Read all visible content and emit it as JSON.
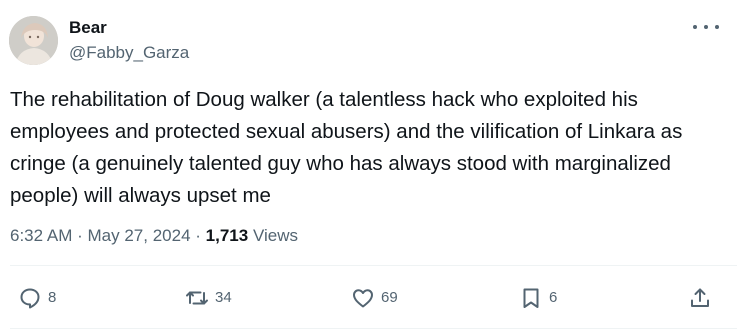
{
  "author": {
    "name": "Bear",
    "handle": "@Fabby_Garza"
  },
  "tweet": {
    "text": "The rehabilitation of Doug walker (a talentless hack who exploited his employees and protected sexual abusers) and the vilification of Linkara as cringe (a genuinely talented guy who has always stood with marginalized people) will always upset me",
    "time": "6:32 AM",
    "date": "May 27, 2024",
    "separator": "·",
    "views_count": "1,713",
    "views_label": "Views"
  },
  "actions": {
    "replies": "8",
    "reposts": "34",
    "likes": "69",
    "bookmarks": "6"
  },
  "icons": {
    "more": "more-horizontal-icon",
    "reply": "reply-icon",
    "repost": "repost-icon",
    "like": "heart-icon",
    "bookmark": "bookmark-icon",
    "share": "share-icon"
  },
  "colors": {
    "text": "#0f1419",
    "secondary": "#536471",
    "divider": "#eff3f4"
  }
}
